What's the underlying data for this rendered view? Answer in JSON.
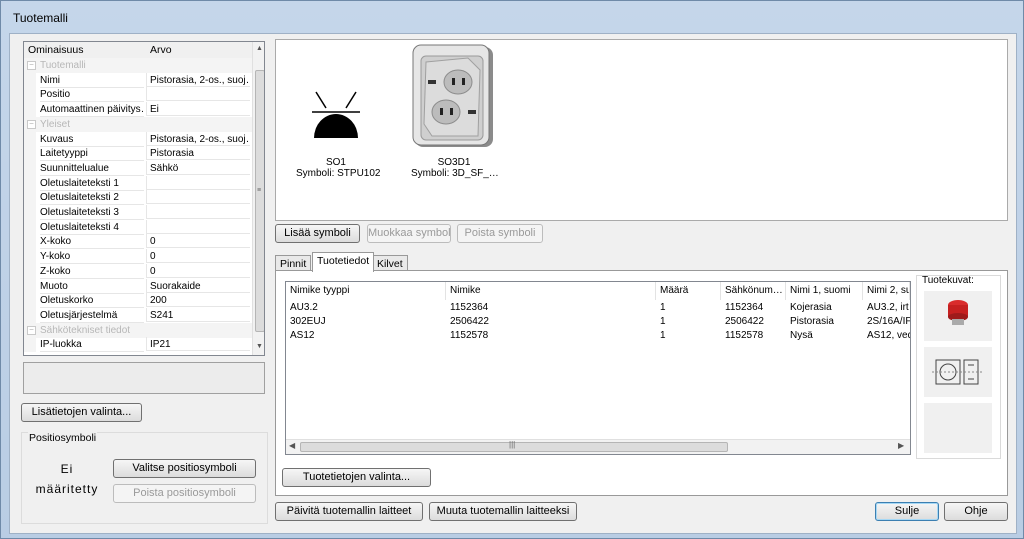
{
  "window": {
    "title": "Tuotemalli"
  },
  "properties": {
    "col_property": "Ominaisuus",
    "col_value": "Arvo",
    "rows": [
      {
        "key": "Tuotemalli",
        "value": "",
        "category": true
      },
      {
        "key": "Nimi",
        "value": "Pistorasia, 2-os., suoj…"
      },
      {
        "key": "Positio",
        "value": ""
      },
      {
        "key": "Automaattinen päivitys…",
        "value": "Ei"
      },
      {
        "key": "Yleiset",
        "value": "",
        "category": true
      },
      {
        "key": "Kuvaus",
        "value": "Pistorasia, 2-os., suoj…"
      },
      {
        "key": "Laitetyyppi",
        "value": "Pistorasia"
      },
      {
        "key": "Suunnittelualue",
        "value": "Sähkö"
      },
      {
        "key": "Oletuslaiteteksti 1",
        "value": ""
      },
      {
        "key": "Oletuslaiteteksti 2",
        "value": ""
      },
      {
        "key": "Oletuslaiteteksti 3",
        "value": ""
      },
      {
        "key": "Oletuslaiteteksti 4",
        "value": ""
      },
      {
        "key": "X-koko",
        "value": "0"
      },
      {
        "key": "Y-koko",
        "value": "0"
      },
      {
        "key": "Z-koko",
        "value": "0"
      },
      {
        "key": "Muoto",
        "value": "Suorakaide"
      },
      {
        "key": "Oletuskorko",
        "value": "200"
      },
      {
        "key": "Oletusjärjestelmä",
        "value": "S241"
      },
      {
        "key": "Sähkötekniset tiedot",
        "value": "",
        "category": true
      },
      {
        "key": "IP-luokka",
        "value": "IP21"
      }
    ]
  },
  "buttons": {
    "extra_info": "Lisätietojen valinta...",
    "add_symbol": "Lisää symboli",
    "edit_symbol": "Muokkaa symbolia",
    "delete_symbol": "Poista symboli",
    "product_info_select": "Tuotetietojen valinta...",
    "update_devices": "Päivitä tuotemallin laitteet",
    "change_to_devices": "Muuta tuotemallin laitteeksi",
    "close": "Sulje",
    "help": "Ohje",
    "select_position_symbol": "Valitse positiosymboli",
    "delete_position_symbol": "Poista positiosymboli"
  },
  "position_symbol": {
    "group_label": "Positiosymboli",
    "not_defined_line1": "Ei",
    "not_defined_line2": "määritetty"
  },
  "symbols": [
    {
      "name": "SO1",
      "symbol": "Symboli: STPU102"
    },
    {
      "name": "SO3D1",
      "symbol": "Symboli: 3D_SF_…"
    }
  ],
  "tabs": [
    "Pinnit",
    "Tuotetiedot",
    "Kilvet"
  ],
  "active_tab": "Tuotetiedot",
  "product_table": {
    "headers": [
      "Nimike tyyppi",
      "Nimike",
      "Määrä",
      "Sähkönum…",
      "Nimi 1, suomi",
      "Nimi 2, su"
    ],
    "rows": [
      [
        "AU3.2",
        "1152364",
        "1",
        "1152364",
        "Kojerasia",
        "AU3.2, irt"
      ],
      [
        "302EUJ",
        "2506422",
        "1",
        "2506422",
        "Pistorasia",
        "2S/16A/IF"
      ],
      [
        "AS12",
        "1152578",
        "1",
        "1152578",
        "Nysä",
        "AS12, ved"
      ]
    ]
  },
  "product_images_label": "Tuotekuvat:"
}
